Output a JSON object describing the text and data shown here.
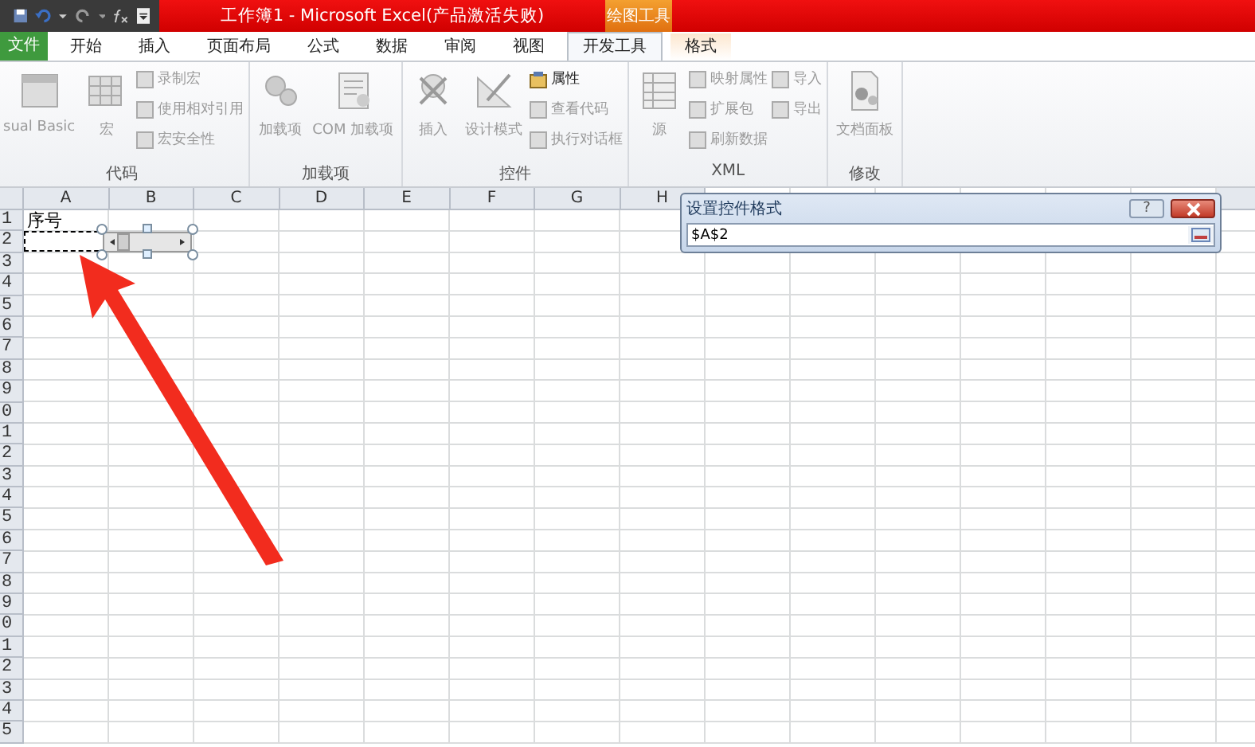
{
  "window": {
    "title": "工作簿1 - Microsoft Excel(产品激活失败)",
    "context_group": "绘图工具"
  },
  "tabs": [
    {
      "label": "文件",
      "kind": "file",
      "selected": false
    },
    {
      "label": "开始",
      "kind": "normal",
      "selected": false
    },
    {
      "label": "插入",
      "kind": "normal",
      "selected": false
    },
    {
      "label": "页面布局",
      "kind": "normal",
      "selected": false
    },
    {
      "label": "公式",
      "kind": "normal",
      "selected": false
    },
    {
      "label": "数据",
      "kind": "normal",
      "selected": false
    },
    {
      "label": "审阅",
      "kind": "normal",
      "selected": false
    },
    {
      "label": "视图",
      "kind": "normal",
      "selected": false
    },
    {
      "label": "开发工具",
      "kind": "normal",
      "selected": true
    },
    {
      "label": "格式",
      "kind": "contextual",
      "selected": false
    }
  ],
  "ribbon_groups": [
    {
      "label": "代码",
      "columns": [
        [
          {
            "label": "sual Basic",
            "kind": "large",
            "disabled": true
          }
        ],
        [
          {
            "label": "宏",
            "kind": "large",
            "disabled": true
          }
        ],
        [
          {
            "label": "录制宏",
            "kind": "small",
            "disabled": true
          },
          {
            "label": "使用相对引用",
            "kind": "small",
            "disabled": true
          },
          {
            "label": "宏安全性",
            "kind": "small",
            "disabled": true
          }
        ]
      ]
    },
    {
      "label": "加载项",
      "columns": [
        [
          {
            "label": "加载项",
            "kind": "large",
            "disabled": true
          }
        ],
        [
          {
            "label": "COM 加载项",
            "kind": "large",
            "disabled": true
          }
        ]
      ]
    },
    {
      "label": "控件",
      "columns": [
        [
          {
            "label": "插入",
            "kind": "large",
            "disabled": true
          }
        ],
        [
          {
            "label": "设计模式",
            "kind": "large",
            "disabled": true
          }
        ],
        [
          {
            "label": "属性",
            "kind": "small",
            "disabled": false
          },
          {
            "label": "查看代码",
            "kind": "small",
            "disabled": true
          },
          {
            "label": "执行对话框",
            "kind": "small",
            "disabled": true
          }
        ]
      ]
    },
    {
      "label": "XML",
      "columns": [
        [
          {
            "label": "源",
            "kind": "large",
            "disabled": true
          }
        ],
        [
          {
            "label": "映射属性",
            "kind": "small",
            "disabled": true
          },
          {
            "label": "扩展包",
            "kind": "small",
            "disabled": true
          },
          {
            "label": "刷新数据",
            "kind": "small",
            "disabled": true
          }
        ],
        [
          {
            "label": "导入",
            "kind": "small",
            "disabled": true
          },
          {
            "label": "导出",
            "kind": "small",
            "disabled": true
          }
        ]
      ]
    },
    {
      "label": "修改",
      "columns": [
        [
          {
            "label": "文档面板",
            "kind": "large",
            "disabled": true
          }
        ]
      ]
    }
  ],
  "sheet": {
    "columns": [
      "A",
      "B",
      "C",
      "D",
      "E",
      "F",
      "G",
      "H"
    ],
    "rows": [
      {
        "header": "1",
        "cells": [
          "序号"
        ]
      },
      {
        "header": "2"
      },
      {
        "header": "3"
      },
      {
        "header": "4"
      },
      {
        "header": "5"
      },
      {
        "header": "6"
      },
      {
        "header": "7"
      },
      {
        "header": "8"
      },
      {
        "header": "9"
      },
      {
        "header": "0"
      },
      {
        "header": "1"
      },
      {
        "header": "2"
      },
      {
        "header": "3"
      },
      {
        "header": "4"
      },
      {
        "header": "5"
      },
      {
        "header": "6"
      },
      {
        "header": "7"
      },
      {
        "header": "8"
      },
      {
        "header": "9"
      },
      {
        "header": "0"
      },
      {
        "header": "1"
      },
      {
        "header": "2"
      },
      {
        "header": "3"
      },
      {
        "header": "4"
      },
      {
        "header": "5"
      }
    ]
  },
  "dialog": {
    "title": "设置控件格式",
    "help_button": "?",
    "value": "$A$2"
  }
}
